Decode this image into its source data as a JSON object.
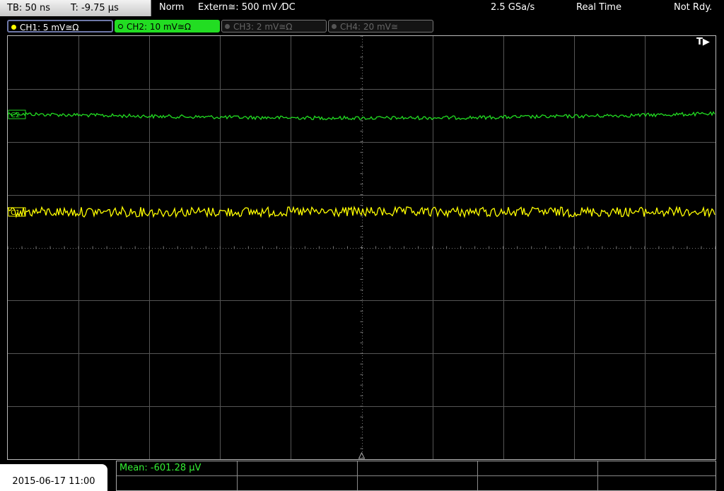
{
  "header": {
    "timebase": "TB: 50 ns",
    "trigger_time": "T: -9.75 µs",
    "mode": "Norm",
    "trigger_source": "Extern≅: 500 mV",
    "trigger_coupling": "DC",
    "sample_rate": "2.5 GSa/s",
    "acquisition": "Real Time",
    "status": "Not Rdy."
  },
  "channels": [
    {
      "label": "CH1: 5 mV≅Ω",
      "color": "#ffff00",
      "active": true
    },
    {
      "label": "CH2: 10 mV≅Ω",
      "color": "#22dd22",
      "active": true
    },
    {
      "label": "CH3: 2 mV≅Ω",
      "color": "#555555",
      "active": false
    },
    {
      "label": "CH4: 20 mV≅",
      "color": "#555555",
      "active": false
    }
  ],
  "screen": {
    "trigger_marker": "T▶",
    "ch2_marker": "C2",
    "ch1_marker": "C1"
  },
  "footer": {
    "datetime": "2015-06-17 11:00",
    "measurement": "Mean: -601.28 µV"
  },
  "colors": {
    "ch1": "#ffff00",
    "ch2": "#22dd22",
    "grid": "#555555"
  }
}
